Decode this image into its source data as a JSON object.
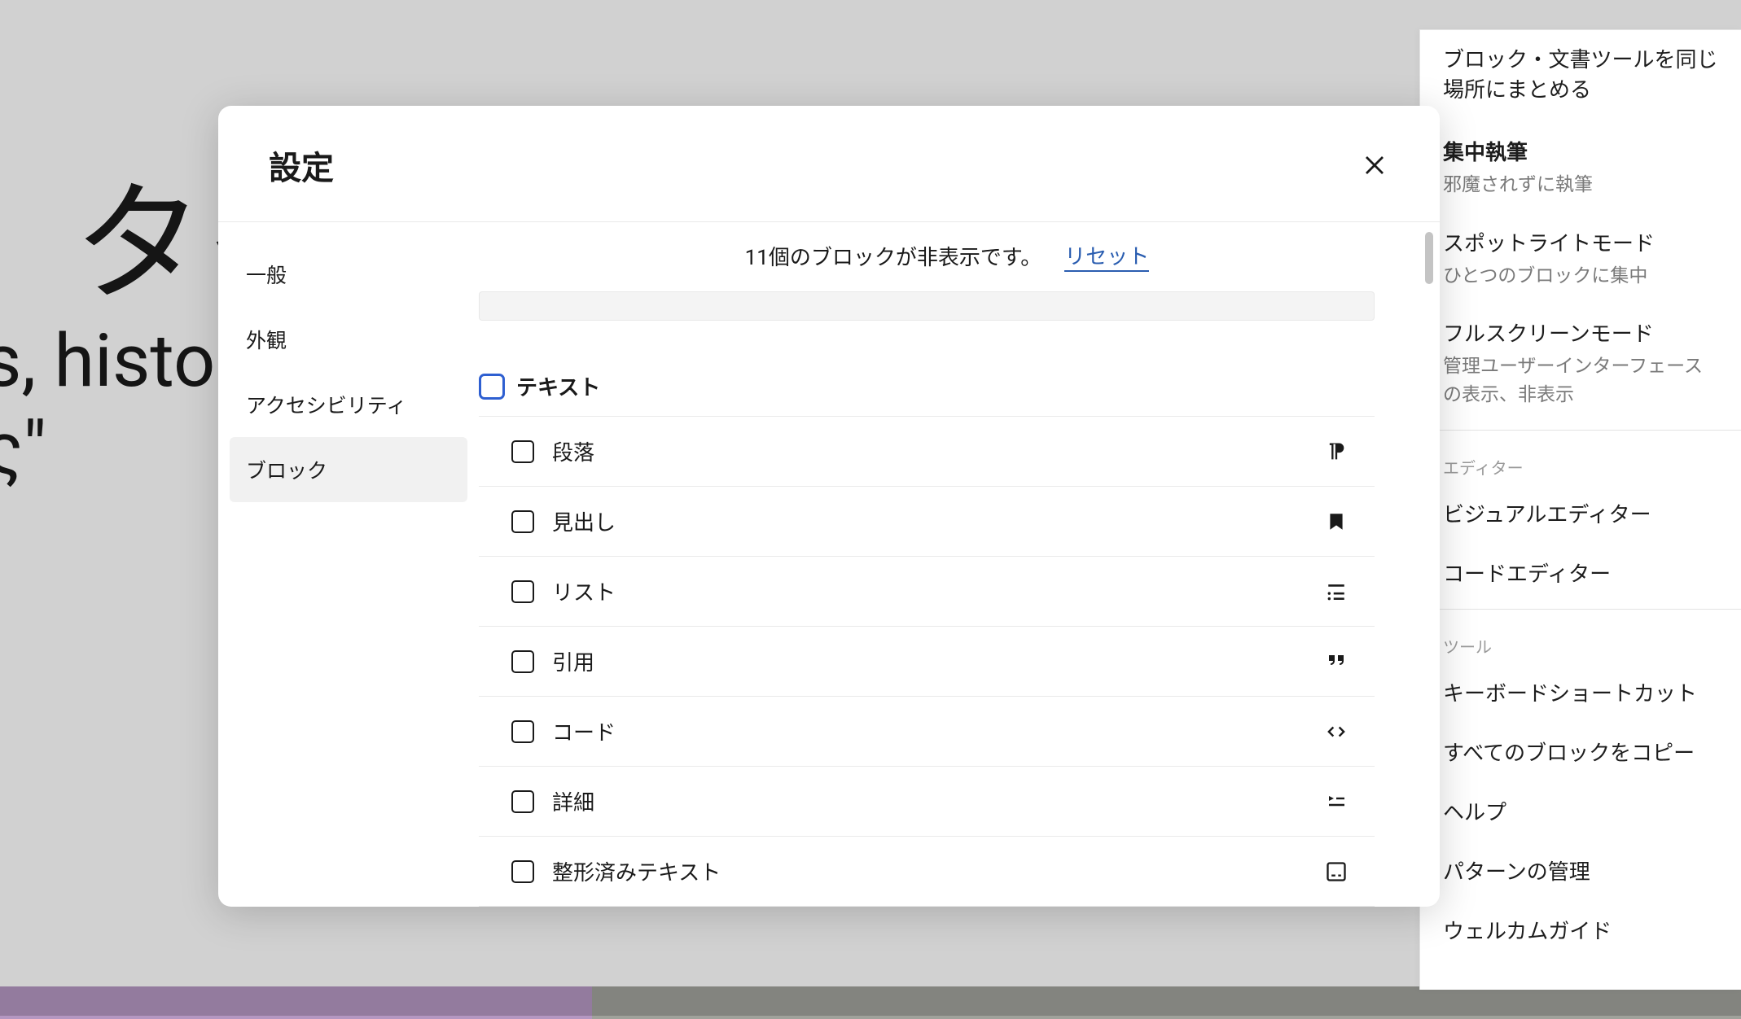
{
  "background": {
    "title_fragment": "タイ",
    "body_fragment_line1": "s, histo",
    "body_fragment_line2": "ς\""
  },
  "options_panel": {
    "items": [
      {
        "title": "ブロック・文書ツールを同じ場所にまとめる",
        "sub": "",
        "bold": false
      },
      {
        "title": "集中執筆",
        "sub": "邪魔されずに執筆",
        "bold": true
      },
      {
        "title": "スポットライトモード",
        "sub": "ひとつのブロックに集中",
        "bold": false
      },
      {
        "title": "フルスクリーンモード",
        "sub": "管理ユーザーインターフェースの表示、非表示",
        "bold": false
      }
    ],
    "editor_section_label": "エディター",
    "editor_items": [
      "ビジュアルエディター",
      "コードエディター"
    ],
    "tools_section_label": "ツール",
    "tools_items": [
      "キーボードショートカット",
      "すべてのブロックをコピー",
      "ヘルプ",
      "パターンの管理",
      "ウェルカムガイド"
    ]
  },
  "modal": {
    "title": "設定",
    "sidebar": {
      "items": [
        {
          "label": "一般",
          "active": false
        },
        {
          "label": "外観",
          "active": false
        },
        {
          "label": "アクセシビリティ",
          "active": false
        },
        {
          "label": "ブロック",
          "active": true
        }
      ]
    },
    "status": {
      "text": "11個のブロックが非表示です。",
      "reset": "リセット"
    },
    "group": {
      "label": "テキスト"
    },
    "blocks": [
      {
        "label": "段落",
        "icon": "paragraph"
      },
      {
        "label": "見出し",
        "icon": "heading"
      },
      {
        "label": "リスト",
        "icon": "list"
      },
      {
        "label": "引用",
        "icon": "quote"
      },
      {
        "label": "コード",
        "icon": "code"
      },
      {
        "label": "詳細",
        "icon": "details"
      },
      {
        "label": "整形済みテキスト",
        "icon": "preformatted"
      }
    ]
  }
}
